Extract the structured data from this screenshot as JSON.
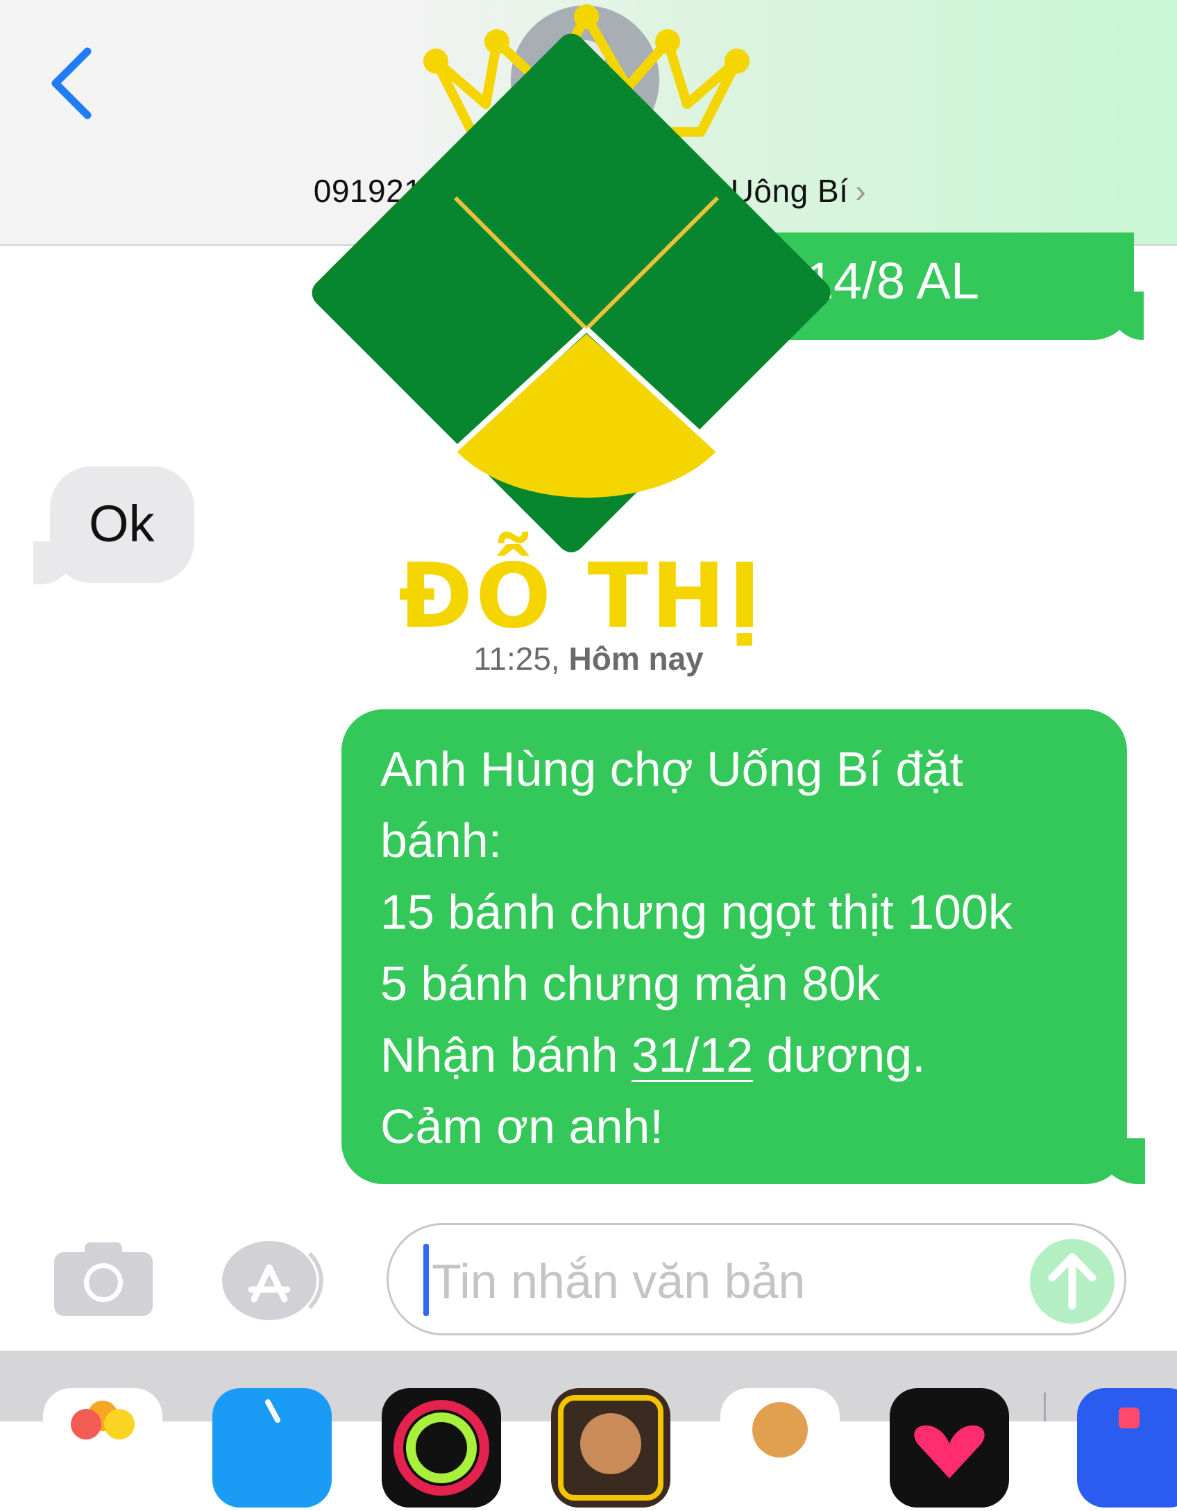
{
  "header": {
    "back_label": "<",
    "contact_name_start": "091921 K",
    "contact_name_end": "Uông Bí",
    "chevron": "›"
  },
  "messages": {
    "first_outgoing_fragment": "14/8 AL",
    "incoming_ok": "Ok",
    "timestamp_time": "11:25,",
    "timestamp_day": "Hôm nay",
    "order": {
      "line1": "Anh Hùng chợ Uống Bí đặt",
      "line2": "bánh:",
      "line3": "15 bánh chưng  ngọt thịt 100k",
      "line4_pre": "5 bánh chưng mặn 80k",
      "line5_pre": "Nhận bánh ",
      "line5_date": "31/12",
      "line5_post": " dương.",
      "line6": "Cảm ơn anh!"
    }
  },
  "composer": {
    "placeholder": "Tin nhắn văn bản",
    "camera_icon": "camera-icon",
    "apps_icon": "app-store-icon",
    "send_icon": "arrow-up-icon"
  },
  "watermark": {
    "brand_text": "ĐỖ THỊ",
    "colors": {
      "green": "#08852f",
      "yellow": "#f5d500",
      "gold": "#e8c23a"
    }
  },
  "colors": {
    "outgoing_bubble": "#34c759",
    "incoming_bubble": "#e9e9eb",
    "accent_blue": "#1f7cf5"
  }
}
